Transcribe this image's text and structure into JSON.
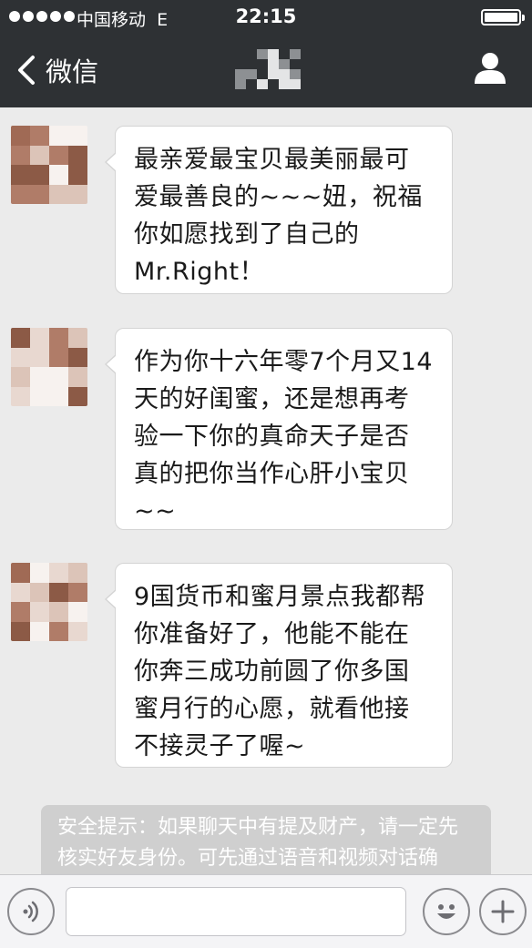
{
  "status_bar": {
    "carrier": "中国移动",
    "network": "E",
    "time": "22:15",
    "battery_level": 1.0
  },
  "nav": {
    "back_label": "微信",
    "back_icon": "chevron-left-icon",
    "profile_icon": "person-icon"
  },
  "messages": [
    {
      "text": "最亲爱最宝贝最美丽最可爱最善良的~~~妞，祝福你如愿找到了自己的Mr.Right！"
    },
    {
      "text": "作为你十六年零7个月又14天的好闺蜜，还是想再考验一下你的真命天子是否真的把你当作心肝小宝贝~~"
    },
    {
      "text": "9国货币和蜜月景点我都帮你准备好了，他能不能在你奔三成功前圆了你多国蜜月行的心愿，就看他接不接灵子了喔~"
    }
  ],
  "notice": {
    "text": "安全提示：如果聊天中有提及财产，请一定先核实好友身份。可先通过语音和视频对话确认。"
  },
  "input_bar": {
    "voice_icon": "voice-icon",
    "emoji_icon": "emoji-icon",
    "plus_icon": "plus-icon",
    "placeholder": ""
  },
  "colors": {
    "header_bg": "#2e3134",
    "chat_bg": "#ebebeb",
    "bubble_bg": "#ffffff",
    "notice_bg": "#cfcfcf"
  }
}
